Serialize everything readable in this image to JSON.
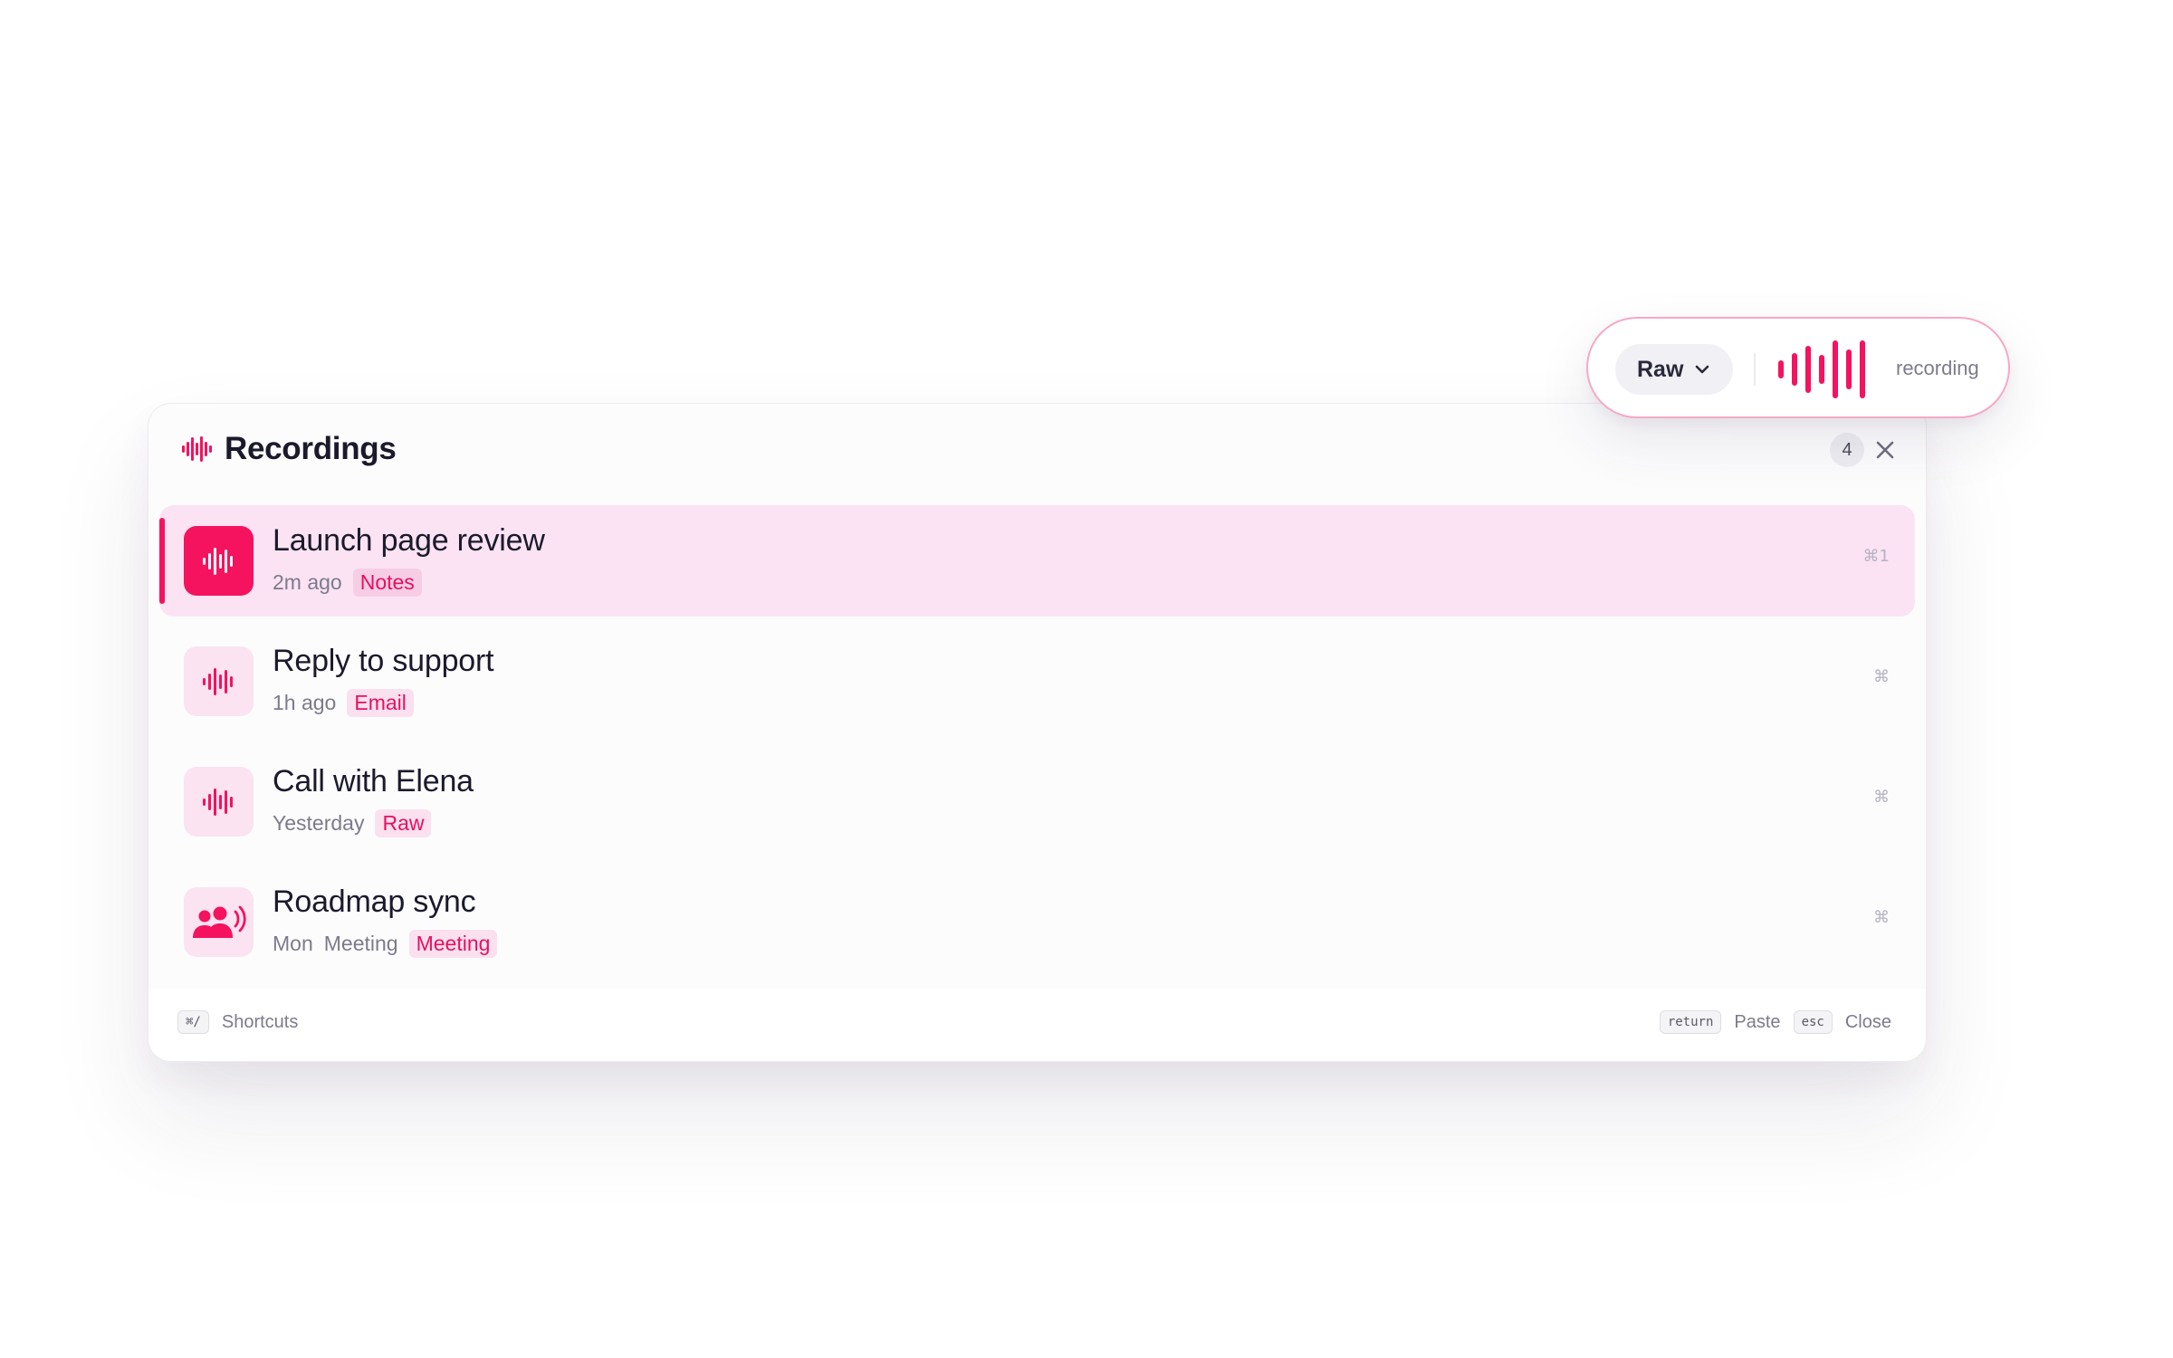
{
  "panel": {
    "title": "Recordings",
    "count": "4",
    "items": [
      {
        "title": "Launch page review",
        "time": "2m ago",
        "extra": "",
        "tag": "Notes",
        "shortcut": "⌘1",
        "icon": "waveform-icon",
        "active": true
      },
      {
        "title": "Reply to support",
        "time": "1h ago",
        "extra": "",
        "tag": "Email",
        "shortcut": "⌘",
        "icon": "waveform-icon",
        "active": false
      },
      {
        "title": "Call with Elena",
        "time": "Yesterday",
        "extra": "",
        "tag": "Raw",
        "shortcut": "⌘",
        "icon": "waveform-icon",
        "active": false
      },
      {
        "title": "Roadmap sync",
        "time": "Mon",
        "extra": "Meeting",
        "tag": "Meeting",
        "shortcut": "⌘",
        "icon": "meeting-people-icon",
        "active": false
      }
    ],
    "footer": {
      "shortcuts_key": "⌘/",
      "shortcuts_label": "Shortcuts",
      "paste_key": "return",
      "paste_label": "Paste",
      "close_key": "esc",
      "close_label": "Close"
    }
  },
  "recorder": {
    "mode": "Raw",
    "status": "recording"
  },
  "colors": {
    "accent": "#f5125f",
    "active_row": "#fbe3f3",
    "tag_bg": "#fbe0ef"
  }
}
